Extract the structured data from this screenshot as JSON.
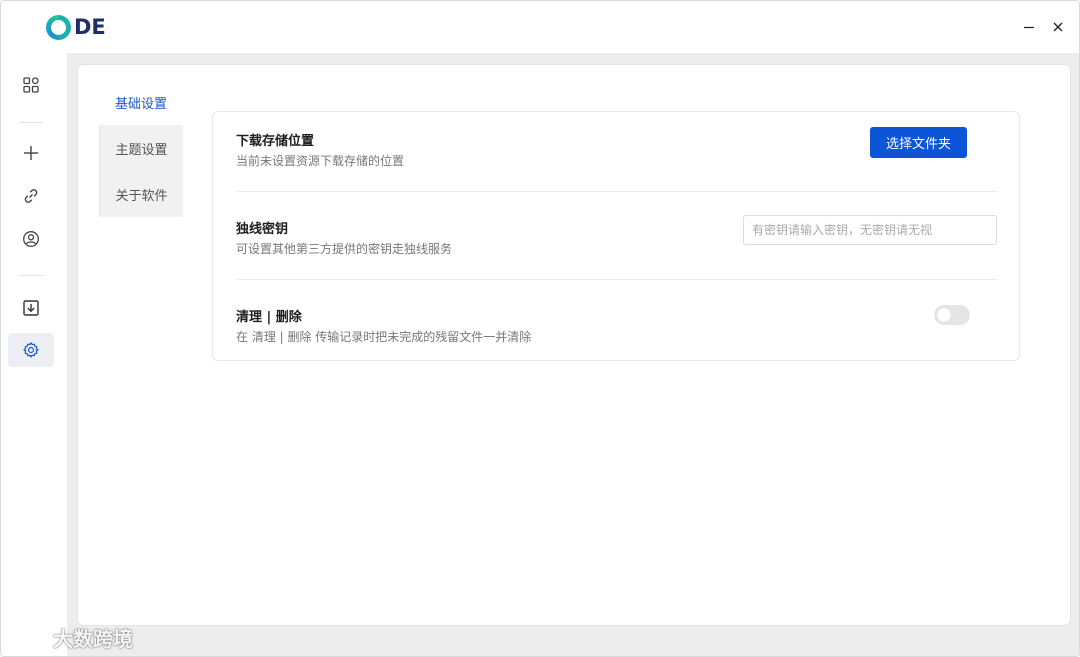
{
  "app": {
    "logo_text": "DE",
    "window": {
      "minimize_symbol": "—",
      "close_symbol": "✕"
    }
  },
  "sidebar": {
    "items": [
      {
        "name": "dashboard",
        "icon": "grid-icon"
      },
      {
        "name": "add",
        "icon": "plus-icon"
      },
      {
        "name": "link",
        "icon": "link-icon"
      },
      {
        "name": "account",
        "icon": "user-circle-icon"
      },
      {
        "name": "download",
        "icon": "download-icon"
      },
      {
        "name": "settings",
        "icon": "gear-icon",
        "active": true
      }
    ],
    "active_color": "#1a58c9"
  },
  "settings": {
    "tabs": [
      {
        "label": "基础设置",
        "active": true
      },
      {
        "label": "主题设置",
        "active": false
      },
      {
        "label": "关于软件",
        "active": false
      }
    ],
    "rows": {
      "download": {
        "title": "下载存储位置",
        "desc": "当前未设置资源下载存储的位置",
        "button_label": "选择文件夹"
      },
      "key": {
        "title": "独线密钥",
        "desc": "可设置其他第三方提供的密钥走独线服务",
        "placeholder": "有密钥请输入密钥，无密钥请无视",
        "value": ""
      },
      "cleanup": {
        "title": "清理 | 删除",
        "desc": "在 清理 | 删除 传输记录时把未完成的残留文件一并清除",
        "toggle_on": false
      }
    }
  },
  "watermark": {
    "text": "大数跨境"
  },
  "colors": {
    "primary": "#0b55d6",
    "accent_tab": "#1a58c9",
    "main_bg": "#ededed"
  }
}
